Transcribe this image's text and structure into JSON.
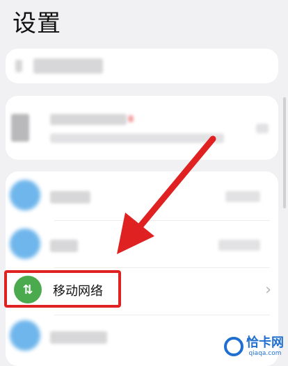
{
  "header": {
    "title": "设置"
  },
  "list": {
    "mobile_network_label": "移动网络",
    "chevron": "›"
  },
  "watermark": {
    "main": "恰卡网",
    "sub": "qiaqa.com"
  },
  "colors": {
    "highlight": "#e02121",
    "arrow": "#e02121",
    "mobile_icon": "#4caa4e",
    "watermark": "#1f6fd1"
  },
  "icons": {
    "mobile_network": "data-arrows-icon",
    "chevron": "chevron-right-icon"
  }
}
